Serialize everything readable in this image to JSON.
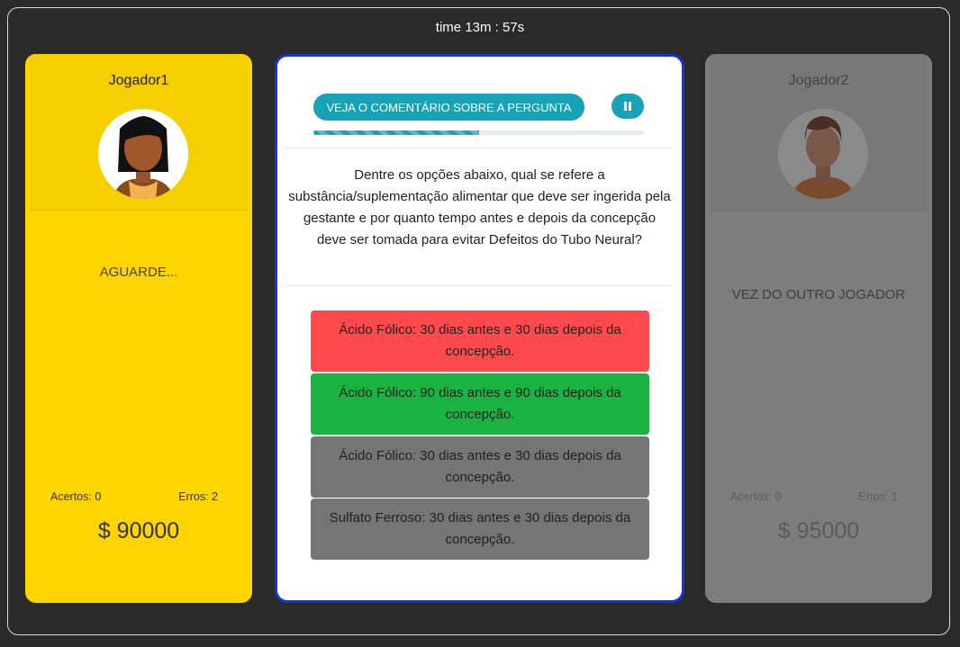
{
  "timer": {
    "label": "time",
    "value": "13m : 57s"
  },
  "player1": {
    "name": "Jogador1",
    "status": "AGUARDE...",
    "hits_label": "Acertos: 0",
    "errors_label": "Erros: 2",
    "money": "$ 90000",
    "card_color": "#ffd500"
  },
  "player2": {
    "name": "Jogador2",
    "status": "VEZ DO OUTRO JOGADOR",
    "hits_label": "Acertos: 0",
    "errors_label": "Erros: 1",
    "money": "$ 95000",
    "card_color": "#7d7d7d"
  },
  "question_card": {
    "comment_button": "VEJA O COMENTÁRIO SOBRE A PERGUNTA",
    "progress_fraction": 0.5,
    "question": "Dentre os opções abaixo, qual se refere a substância/suplementação alimentar que deve ser ingerida pela gestante e por quanto tempo antes e depois da concepção deve ser tomada para evitar Defeitos do Tubo Neural?",
    "answers": [
      {
        "text": "Ácido Fólico: 30 dias antes e 30 dias depois da concepção.",
        "state": "wrong",
        "color": "#ff4a4d"
      },
      {
        "text": "Ácido Fólico: 90 dias antes e 90 dias depois da concepção.",
        "state": "correct",
        "color": "#1ab240"
      },
      {
        "text": "Ácido Fólico: 30 dias antes e 30 dias depois da concepção.",
        "state": "neutral",
        "color": "#757575"
      },
      {
        "text": "Sulfato Ferroso: 30 dias antes e 30 dias depois da concepção.",
        "state": "neutral",
        "color": "#757575"
      }
    ]
  },
  "icons": {
    "pause": "pause-icon",
    "avatar1": "woman-avatar-icon",
    "avatar2": "man-avatar-icon"
  }
}
